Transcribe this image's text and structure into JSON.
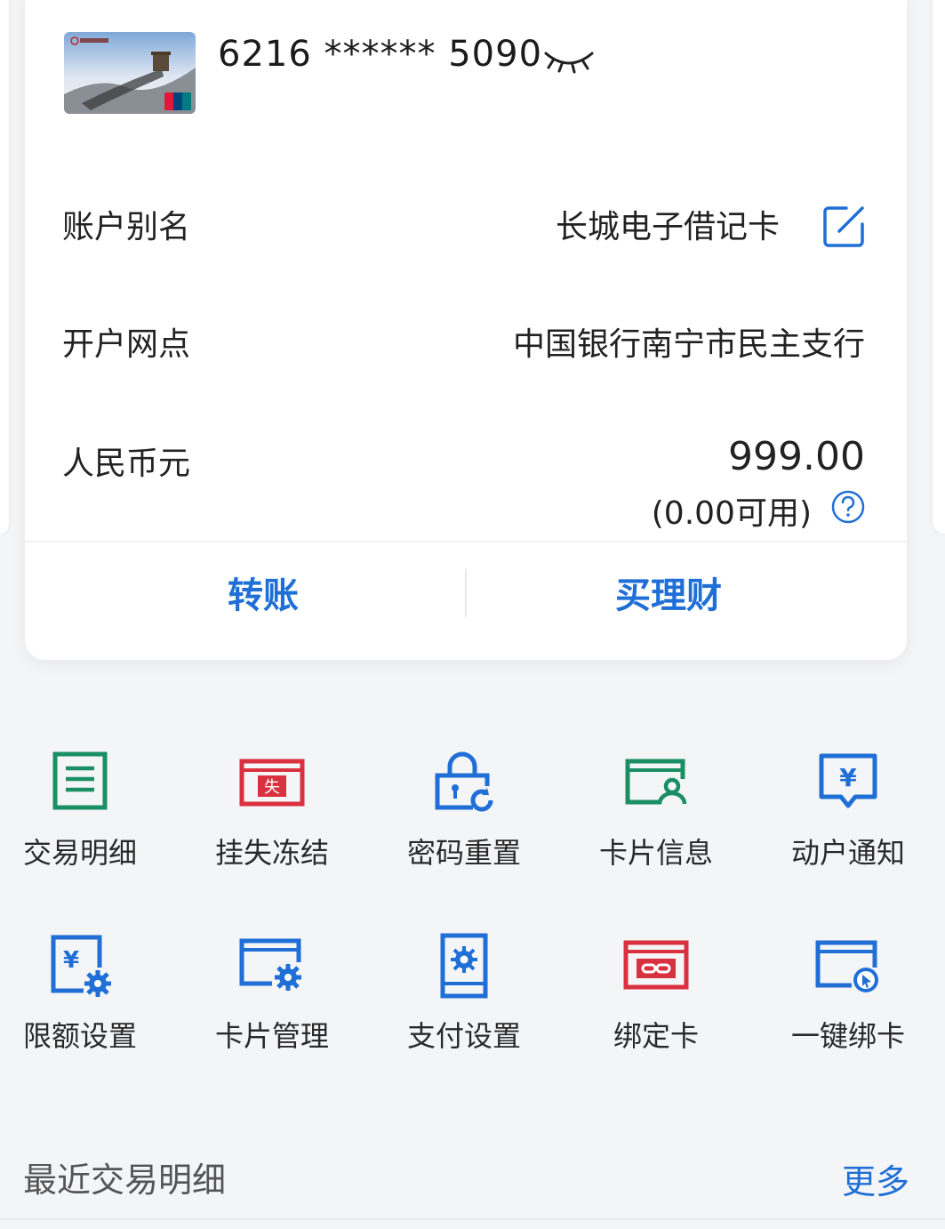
{
  "account_card": {
    "card_number": "6216 ****** 5090",
    "alias_label": "账户别名",
    "alias_value": "长城电子借记卡",
    "branch_label": "开户网点",
    "branch_value": "中国银行南宁市民主支行",
    "currency_label": "人民币元",
    "balance": "999.00",
    "available": "(0.00可用)"
  },
  "actions": {
    "transfer": "转账",
    "buy_wealth": "买理财"
  },
  "services": [
    {
      "label": "交易明细",
      "icon": "document-list-icon"
    },
    {
      "label": "挂失冻结",
      "icon": "report-loss-icon"
    },
    {
      "label": "密码重置",
      "icon": "lock-reset-icon"
    },
    {
      "label": "卡片信息",
      "icon": "card-user-icon"
    },
    {
      "label": "动户通知",
      "icon": "yuan-message-icon"
    },
    {
      "label": "限额设置",
      "icon": "yuan-settings-icon"
    },
    {
      "label": "卡片管理",
      "icon": "card-settings-icon"
    },
    {
      "label": "支付设置",
      "icon": "phone-settings-icon"
    },
    {
      "label": "绑定卡",
      "icon": "card-link-icon"
    },
    {
      "label": "一键绑卡",
      "icon": "card-click-icon"
    }
  ],
  "recent": {
    "title": "最近交易明细",
    "more": "更多"
  },
  "colors": {
    "accent_blue": "#1f6fd6",
    "green": "#1a8f63",
    "red": "#d9313f"
  }
}
